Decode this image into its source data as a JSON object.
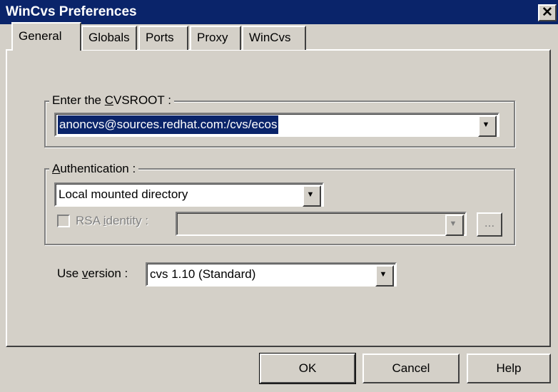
{
  "window": {
    "title": "WinCvs Preferences",
    "close_glyph": "✕"
  },
  "tabs": [
    {
      "label": "General",
      "active": true
    },
    {
      "label": "Globals",
      "active": false
    },
    {
      "label": "Ports",
      "active": false
    },
    {
      "label": "Proxy",
      "active": false
    },
    {
      "label": "WinCvs",
      "active": false
    }
  ],
  "cvsroot": {
    "label_pre": "Enter the ",
    "label_mnemonic": "C",
    "label_post": "VSROOT :",
    "value": "anoncvs@sources.redhat.com:/cvs/ecos"
  },
  "authentication": {
    "label_mnemonic": "A",
    "label_post": "uthentication :",
    "value": "Local mounted directory",
    "rsa_label_pre": "RSA ",
    "rsa_label_mnemonic": "i",
    "rsa_label_post": "dentity :",
    "rsa_value": "",
    "browse_label": "..."
  },
  "version": {
    "label_pre": "Use ",
    "label_mnemonic": "v",
    "label_post": "ersion :",
    "value": "cvs 1.10 (Standard)"
  },
  "buttons": {
    "ok": "OK",
    "cancel": "Cancel",
    "help": "Help"
  },
  "icons": {
    "dropdown_arrow": "▼"
  },
  "colors": {
    "titlebar": "#0a246a",
    "face": "#d4d0c8",
    "selection": "#0a246a"
  }
}
